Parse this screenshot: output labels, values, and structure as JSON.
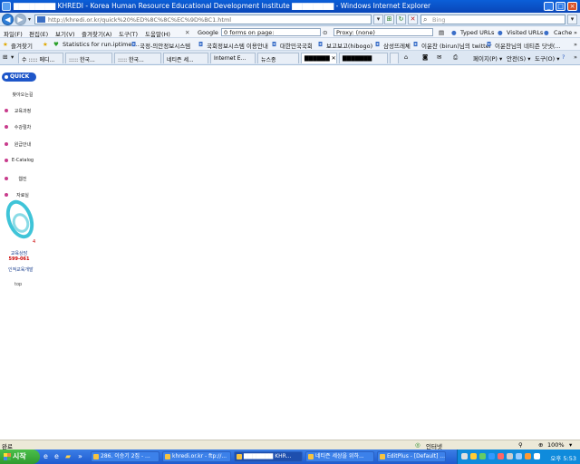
{
  "window": {
    "title": "▇▇▇▇▇▇▇▇ KHREDI - Korea Human Resource Educational Development Institute ▇▇▇▇▇▇▇▇ - Windows Internet Explorer",
    "buttons": [
      "_",
      "□",
      "×"
    ]
  },
  "address": {
    "url": "http://khredi.or.kr/quick%20%ED%8C%8C%EC%9D%BC1.html",
    "search_placeholder": "Bing"
  },
  "menu": {
    "items": [
      "파일(F)",
      "편집(E)",
      "보기(V)",
      "즐겨찾기(A)",
      "도구(T)",
      "도움말(H)"
    ],
    "google": "Google",
    "forms_select": "0 forms on page:",
    "proxy_select": "Proxy: (none)",
    "typed_urls": "Typed URLs",
    "visited_urls": "Visited URLs",
    "cache": "Cache"
  },
  "favorites": {
    "label": "즐겨찾기",
    "items": [
      "Statistics for run.iptime....",
      "국정-의안정보시스템",
      "국회정보시스템 이용안내",
      "대한민국국회",
      "보고보고(hibogo)",
      "삼성뜨레체",
      "이윤찬 (birun)님의 twitter",
      "이윤찬님의 네티즌 닷넷(..."
    ]
  },
  "tabs": [
    {
      "label": "수 ::::: 메디..."
    },
    {
      "label": "::::: 한국..."
    },
    {
      "label": "::::: 한국..."
    },
    {
      "label": "네티즌 세..."
    },
    {
      "label": "Internet E..."
    },
    {
      "label": "뉴스종"
    },
    {
      "label": "▇▇▇▇▇▇"
    },
    {
      "label": "▇▇▇▇▇▇▇"
    }
  ],
  "cmdbar": {
    "page": "페이지(P) ▾",
    "safety": "안전(S) ▾",
    "tools": "도구(O) ▾"
  },
  "quick": {
    "header": "QUICK",
    "links": [
      "찾아오는길",
      "교육과정",
      "수강절차",
      "원급안내",
      "E-Catalog",
      "웹진",
      "자료실"
    ],
    "number_four": "4",
    "tel_label": "교육상담",
    "tel_number": "599-061",
    "center": "인적교육개발",
    "top": "top"
  },
  "status": {
    "left": "완료",
    "zone": "인터넷",
    "zoom": "100%"
  },
  "taskbar": {
    "start": "시작",
    "items": [
      "286. 이승기 2집 - ...",
      "khredi.or.kr - ftp://...",
      "▇▇▇▇▇▇▇ KHR...",
      "네티즌 세상을 위하...",
      "EditPlus - [Default] ..."
    ],
    "clock": "오후 5:53"
  }
}
